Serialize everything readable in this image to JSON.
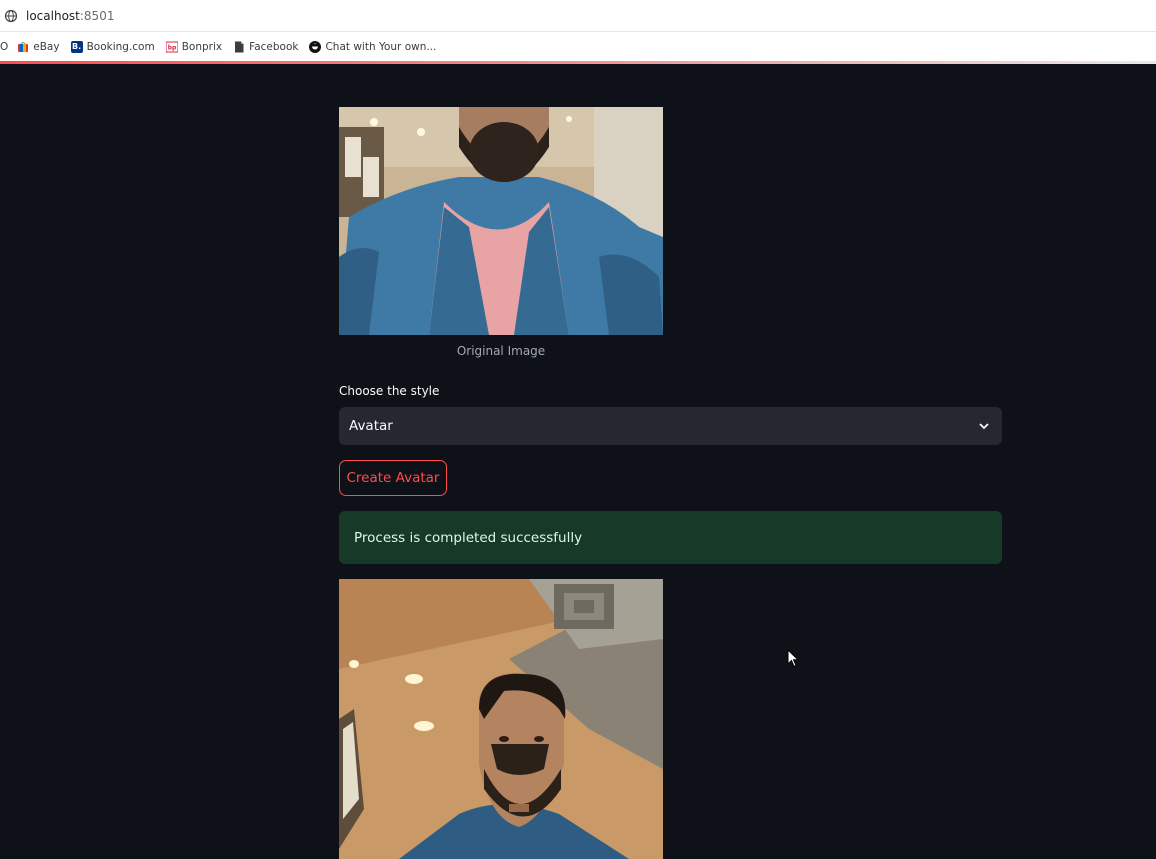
{
  "browser": {
    "url_host": "localhost",
    "url_port": ":8501",
    "bookmarks": [
      {
        "label": "eBay",
        "icon": "ebay-icon"
      },
      {
        "label": "Booking.com",
        "icon": "booking-icon"
      },
      {
        "label": "Bonprix",
        "icon": "bonprix-icon"
      },
      {
        "label": "Facebook",
        "icon": "document-icon"
      },
      {
        "label": "Chat with Your own...",
        "icon": "chat-icon"
      }
    ],
    "bookmark_leading": "O"
  },
  "app": {
    "original_caption": "Original Image",
    "style_label": "Choose the style",
    "style_selected": "Avatar",
    "create_button": "Create Avatar",
    "success_message": "Process is completed successfully"
  },
  "colors": {
    "background": "#0e1117",
    "accent": "#ff4b4b",
    "success_bg": "#173928",
    "select_bg": "#262730"
  }
}
